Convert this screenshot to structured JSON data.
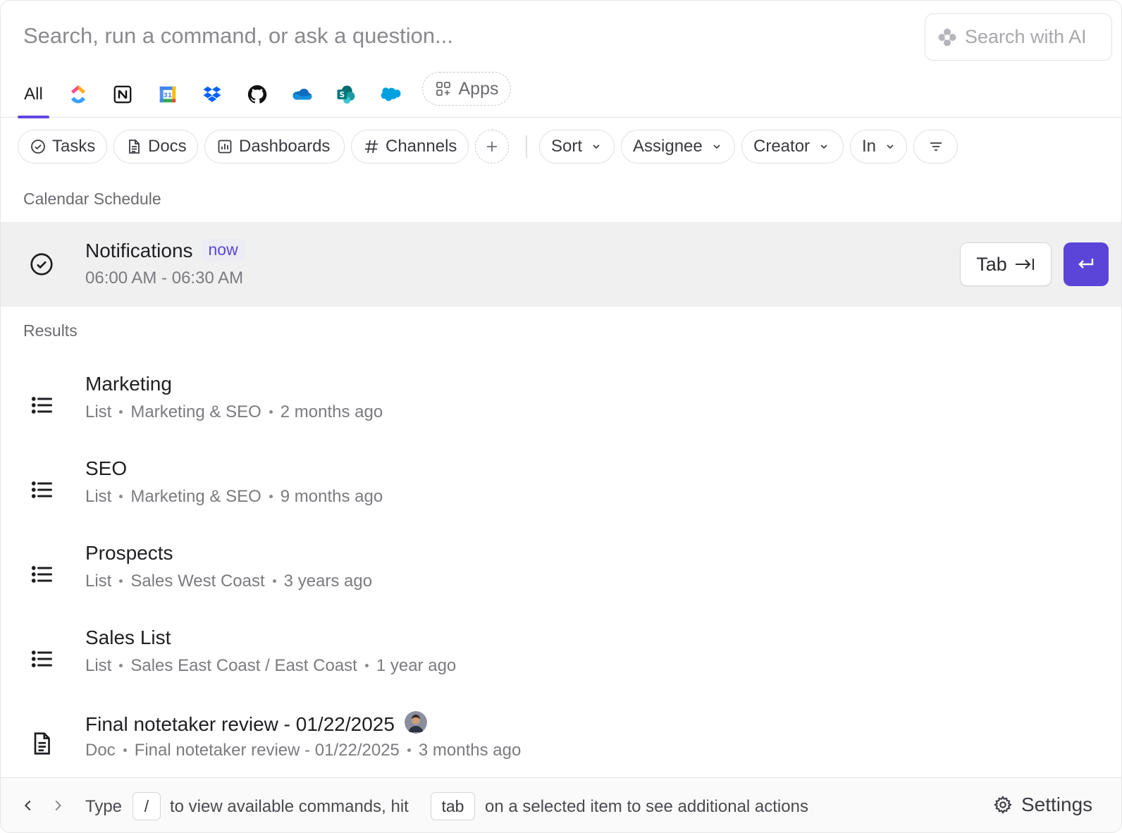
{
  "search": {
    "placeholder": "Search, run a command, or ask a question...",
    "ai_button_label": "Search with AI"
  },
  "sources": {
    "all_label": "All",
    "icons": [
      "clickup-icon",
      "notion-icon",
      "google-calendar-icon",
      "dropbox-icon",
      "github-icon",
      "onedrive-icon",
      "sharepoint-icon",
      "salesforce-icon"
    ],
    "apps_label": "Apps"
  },
  "filters": {
    "tasks": "Tasks",
    "docs": "Docs",
    "dashboards": "Dashboards",
    "channels": "Channels",
    "sort": "Sort",
    "assignee": "Assignee",
    "creator": "Creator",
    "in": "In"
  },
  "calendar": {
    "section_label": "Calendar Schedule",
    "event": {
      "title": "Notifications",
      "badge": "now",
      "time": "06:00 AM - 06:30 AM",
      "tab_key": "Tab"
    }
  },
  "results": {
    "section_label": "Results",
    "items": [
      {
        "title": "Marketing",
        "type": "List",
        "location": "Marketing & SEO",
        "time": "2 months ago",
        "icon": "list-icon"
      },
      {
        "title": "SEO",
        "type": "List",
        "location": "Marketing & SEO",
        "time": "9 months ago",
        "icon": "list-icon"
      },
      {
        "title": "Prospects",
        "type": "List",
        "location": "Sales West Coast",
        "time": "3 years ago",
        "icon": "list-icon"
      },
      {
        "title": "Sales List",
        "type": "List",
        "location": "Sales East Coast / East Coast",
        "time": "1 year ago",
        "icon": "list-icon"
      },
      {
        "title": "Final notetaker review - 01/22/2025",
        "type": "Doc",
        "location": "Final notetaker review - 01/22/2025",
        "time": "3 months ago",
        "icon": "doc-icon"
      }
    ]
  },
  "footer": {
    "type_label": "Type",
    "slash_key": "/",
    "middle_text": "to view available commands, hit",
    "tab_key": "tab",
    "end_text": "on a selected item to see additional actions",
    "settings_label": "Settings"
  },
  "colors": {
    "accent": "#5b45d9",
    "tab_underline": "#6447e0",
    "highlight_row": "#f0f0f1"
  }
}
